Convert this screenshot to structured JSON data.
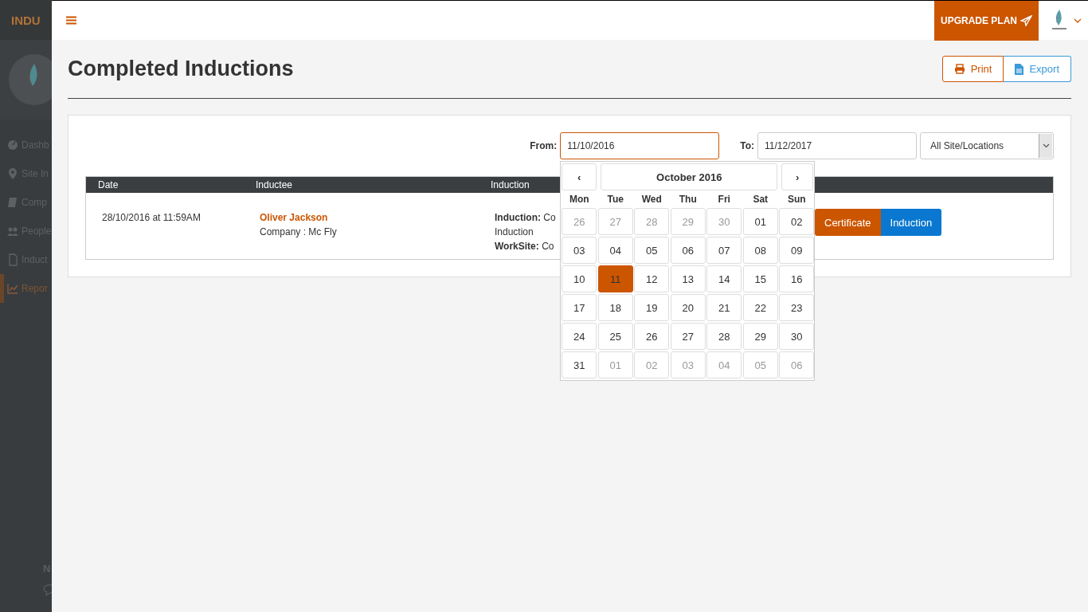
{
  "sidebar": {
    "brand": "INDU",
    "items": [
      {
        "kind": "dashboard",
        "label": "Dashb",
        "selected": false
      },
      {
        "kind": "pin",
        "label": "Site In",
        "selected": false
      },
      {
        "kind": "book",
        "label": "Comp",
        "selected": false
      },
      {
        "kind": "people",
        "label": "People",
        "selected": false
      },
      {
        "kind": "doc",
        "label": "Induct",
        "selected": false
      },
      {
        "kind": "chart",
        "label": "Repor",
        "selected": true
      }
    ],
    "footer": "N"
  },
  "topbar": {
    "upgrade_button": "UPGRADE PLAN"
  },
  "page": {
    "title": "Completed Inductions",
    "buttons": [
      {
        "kind": "print",
        "label": "Print"
      },
      {
        "kind": "export",
        "label": "Export"
      }
    ]
  },
  "filters": {
    "from_label": "From:",
    "from_value": "11/10/2016",
    "to_label": "To:",
    "to_value": "11/12/2017",
    "site_select": "All Site/Locations"
  },
  "table": {
    "columns": [
      "Date",
      "Inductee",
      "Induction"
    ],
    "rows": [
      {
        "date": "28/10/2016 at 11:59AM",
        "name": "Oliver Jackson",
        "company": "Company : Mc Fly",
        "induction_lines": [
          "**Induction:** Co",
          "Induction",
          "**WorkSite:** Co"
        ],
        "actions": [
          {
            "kind": "certificate",
            "label": "Certificate"
          },
          {
            "kind": "induction",
            "label": "Induction"
          }
        ]
      }
    ]
  },
  "datepicker": {
    "prev": "‹",
    "next": "›",
    "month": "October 2016",
    "weekdays": [
      "Mon",
      "Tue",
      "Wed",
      "Thu",
      "Fri",
      "Sat",
      "Sun"
    ],
    "weeks": [
      [
        {
          "day": "26",
          "other_month": true,
          "selected": false
        },
        {
          "day": "27",
          "other_month": true,
          "selected": false
        },
        {
          "day": "28",
          "other_month": true,
          "selected": false
        },
        {
          "day": "29",
          "other_month": true,
          "selected": false
        },
        {
          "day": "30",
          "other_month": true,
          "selected": false
        },
        {
          "day": "01",
          "other_month": false,
          "selected": false
        },
        {
          "day": "02",
          "other_month": false,
          "selected": false
        }
      ],
      [
        {
          "day": "03",
          "other_month": false,
          "selected": false
        },
        {
          "day": "04",
          "other_month": false,
          "selected": false
        },
        {
          "day": "05",
          "other_month": false,
          "selected": false
        },
        {
          "day": "06",
          "other_month": false,
          "selected": false
        },
        {
          "day": "07",
          "other_month": false,
          "selected": false
        },
        {
          "day": "08",
          "other_month": false,
          "selected": false
        },
        {
          "day": "09",
          "other_month": false,
          "selected": false
        }
      ],
      [
        {
          "day": "10",
          "other_month": false,
          "selected": false
        },
        {
          "day": "11",
          "other_month": false,
          "selected": true
        },
        {
          "day": "12",
          "other_month": false,
          "selected": false
        },
        {
          "day": "13",
          "other_month": false,
          "selected": false
        },
        {
          "day": "14",
          "other_month": false,
          "selected": false
        },
        {
          "day": "15",
          "other_month": false,
          "selected": false
        },
        {
          "day": "16",
          "other_month": false,
          "selected": false
        }
      ],
      [
        {
          "day": "17",
          "other_month": false,
          "selected": false
        },
        {
          "day": "18",
          "other_month": false,
          "selected": false
        },
        {
          "day": "19",
          "other_month": false,
          "selected": false
        },
        {
          "day": "20",
          "other_month": false,
          "selected": false
        },
        {
          "day": "21",
          "other_month": false,
          "selected": false
        },
        {
          "day": "22",
          "other_month": false,
          "selected": false
        },
        {
          "day": "23",
          "other_month": false,
          "selected": false
        }
      ],
      [
        {
          "day": "24",
          "other_month": false,
          "selected": false
        },
        {
          "day": "25",
          "other_month": false,
          "selected": false
        },
        {
          "day": "26",
          "other_month": false,
          "selected": false
        },
        {
          "day": "27",
          "other_month": false,
          "selected": false
        },
        {
          "day": "28",
          "other_month": false,
          "selected": false
        },
        {
          "day": "29",
          "other_month": false,
          "selected": false
        },
        {
          "day": "30",
          "other_month": false,
          "selected": false
        }
      ],
      [
        {
          "day": "31",
          "other_month": false,
          "selected": false
        },
        {
          "day": "01",
          "other_month": true,
          "selected": false
        },
        {
          "day": "02",
          "other_month": true,
          "selected": false
        },
        {
          "day": "03",
          "other_month": true,
          "selected": false
        },
        {
          "day": "04",
          "other_month": true,
          "selected": false
        },
        {
          "day": "05",
          "other_month": true,
          "selected": false
        },
        {
          "day": "06",
          "other_month": true,
          "selected": false
        }
      ]
    ]
  }
}
